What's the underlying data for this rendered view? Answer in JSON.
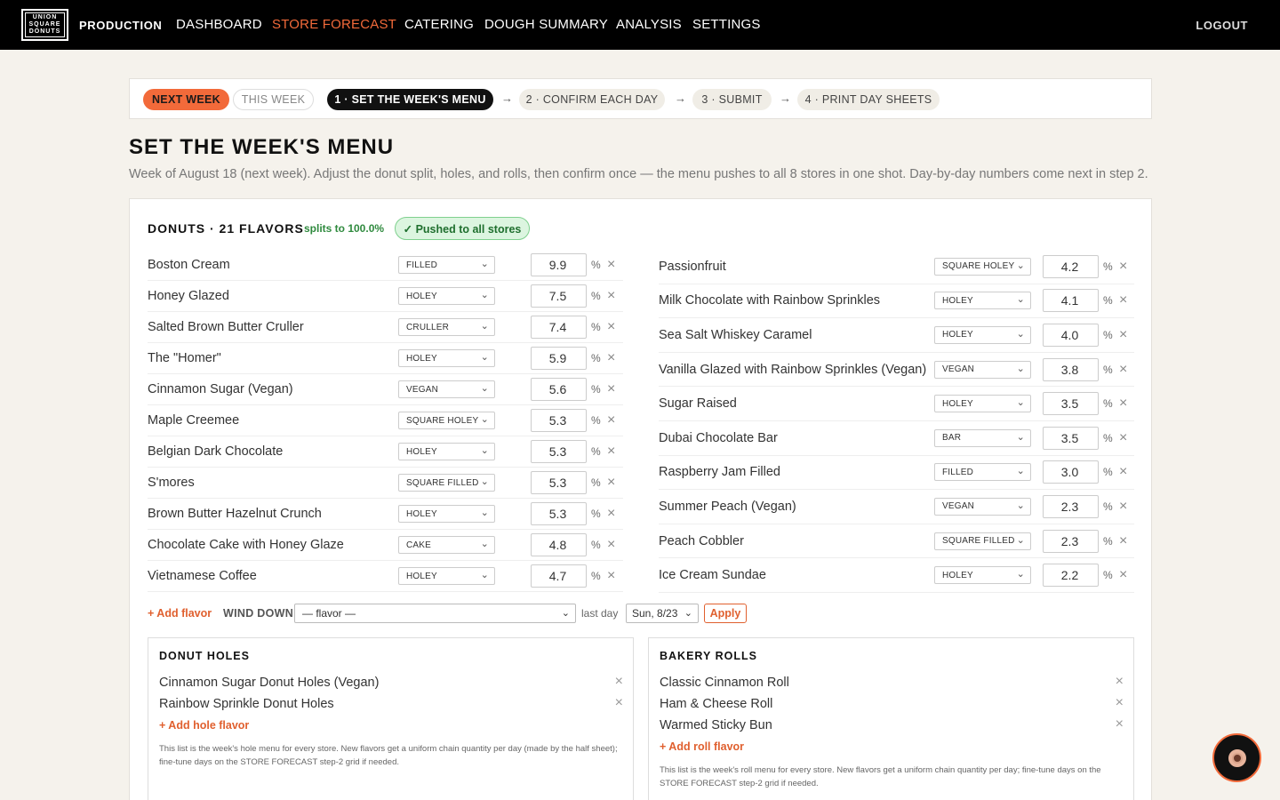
{
  "brand": {
    "logo_lines": [
      "UNION",
      "SQUARE",
      "DONUTS"
    ]
  },
  "nav": {
    "items": [
      {
        "label": "PRODUCTION"
      },
      {
        "label": "DASHBOARD"
      },
      {
        "label": "STORE FORECAST",
        "active": true
      },
      {
        "label": "CATERING"
      },
      {
        "label": "DOUGH SUMMARY"
      },
      {
        "label": "ANALYSIS"
      },
      {
        "label": "SETTINGS"
      }
    ],
    "logout": "LOGOUT"
  },
  "stepper": {
    "next_week": "NEXT WEEK",
    "this_week": "THIS WEEK",
    "steps": [
      "1 · SET THE WEEK'S MENU",
      "2 · CONFIRM EACH DAY",
      "3 · SUBMIT",
      "4 · PRINT DAY SHEETS"
    ],
    "arrow": "→"
  },
  "page": {
    "title": "SET THE WEEK'S MENU",
    "subtitle": "Week of August 18 (next week). Adjust the donut split, holes, and rolls, then confirm once — the menu pushes to all 8 stores in one shot. Day-by-day numbers come next in step 2."
  },
  "donuts": {
    "heading": "DONUTS · 21 FLAVORS",
    "splits": "splits to 100.0%",
    "pushed": "✓ Pushed to all stores",
    "percent_sign": "%",
    "left": [
      {
        "name": "Boston Cream",
        "type": "FILLED",
        "pct": "9.9"
      },
      {
        "name": "Honey Glazed",
        "type": "HOLEY",
        "pct": "7.5"
      },
      {
        "name": "Salted Brown Butter Cruller",
        "type": "CRULLER",
        "pct": "7.4"
      },
      {
        "name": "The \"Homer\"",
        "type": "HOLEY",
        "pct": "5.9"
      },
      {
        "name": "Cinnamon Sugar (Vegan)",
        "type": "VEGAN",
        "pct": "5.6"
      },
      {
        "name": "Maple Creemee",
        "type": "SQUARE HOLEY",
        "pct": "5.3"
      },
      {
        "name": "Belgian Dark Chocolate",
        "type": "HOLEY",
        "pct": "5.3"
      },
      {
        "name": "S'mores",
        "type": "SQUARE FILLED",
        "pct": "5.3"
      },
      {
        "name": "Brown Butter Hazelnut Crunch",
        "type": "HOLEY",
        "pct": "5.3"
      },
      {
        "name": "Chocolate Cake with Honey Glaze",
        "type": "CAKE",
        "pct": "4.8"
      },
      {
        "name": "Vietnamese Coffee",
        "type": "HOLEY",
        "pct": "4.7"
      }
    ],
    "right": [
      {
        "name": "Passionfruit",
        "type": "SQUARE HOLEY",
        "pct": "4.2"
      },
      {
        "name": "Milk Chocolate with Rainbow Sprinkles",
        "type": "HOLEY",
        "pct": "4.1"
      },
      {
        "name": "Sea Salt Whiskey Caramel",
        "type": "HOLEY",
        "pct": "4.0"
      },
      {
        "name": "Vanilla Glazed with Rainbow Sprinkles (Vegan)",
        "type": "VEGAN",
        "pct": "3.8"
      },
      {
        "name": "Sugar Raised",
        "type": "HOLEY",
        "pct": "3.5"
      },
      {
        "name": "Dubai Chocolate Bar",
        "type": "BAR",
        "pct": "3.5"
      },
      {
        "name": "Raspberry Jam Filled",
        "type": "FILLED",
        "pct": "3.0"
      },
      {
        "name": "Summer Peach (Vegan)",
        "type": "VEGAN",
        "pct": "2.3"
      },
      {
        "name": "Peach Cobbler",
        "type": "SQUARE FILLED",
        "pct": "2.3"
      },
      {
        "name": "Ice Cream Sundae",
        "type": "HOLEY",
        "pct": "2.2"
      }
    ],
    "add_flavor": "+ Add flavor",
    "wind_down_label": "WIND DOWN",
    "wind_down_value": "— flavor —",
    "last_day_label": "last day",
    "last_day_value": "Sun, 8/23",
    "apply": "Apply"
  },
  "holes": {
    "heading": "DONUT HOLES",
    "items": [
      "Cinnamon Sugar Donut Holes (Vegan)",
      "Rainbow Sprinkle Donut Holes"
    ],
    "add": "+ Add hole flavor",
    "note": "This list is the week's hole menu for every store. New flavors get a uniform chain quantity per day (made by the half sheet); fine-tune days on the STORE FORECAST step-2 grid if needed."
  },
  "rolls": {
    "heading": "BAKERY ROLLS",
    "items": [
      "Classic Cinnamon Roll",
      "Ham & Cheese Roll",
      "Warmed Sticky Bun"
    ],
    "add": "+ Add roll flavor",
    "note": "This list is the week's roll menu for every store. New flavors get a uniform chain quantity per day; fine-tune days on the STORE FORECAST step-2 grid if needed."
  },
  "icons": {
    "close": "×",
    "chevron": "⌄"
  },
  "colors": {
    "accent": "#f26a3a",
    "success": "#2f8a3e",
    "nav_bg": "#000000",
    "page_bg": "#f5f2ec"
  }
}
